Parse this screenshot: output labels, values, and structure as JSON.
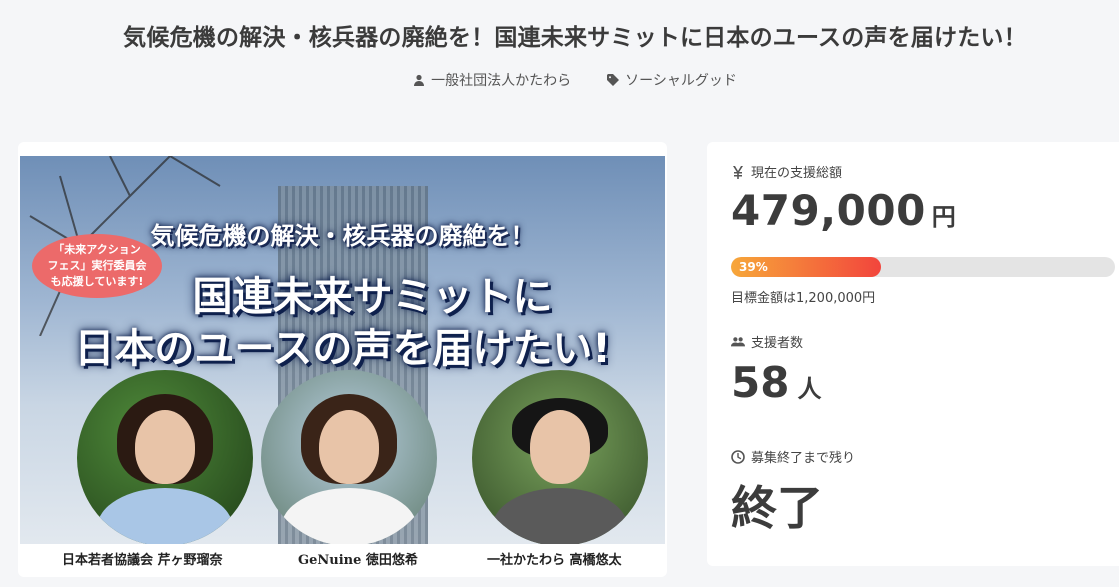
{
  "project": {
    "title": "気候危機の解決・核兵器の廃絶を！国連未来サミットに日本のユースの声を届けたい！",
    "owner": "一般社団法人かたわら",
    "category": "ソーシャルグッド",
    "owner_icon": "user-icon",
    "category_icon": "tag-icon"
  },
  "hero": {
    "headline_line1": "気候危機の解決・核兵器の廃絶を！",
    "headline_line2": "国連未来サミットに",
    "headline_line3": "日本のユースの声を届けたい!",
    "badge_line1": "「未来アクション",
    "badge_line2": "フェス」実行委員会",
    "badge_line3": "も応援しています!",
    "captions": [
      "日本若者協議会 芹ヶ野瑠奈",
      "GeNuine 徳田悠希",
      "一社かたわら 高橋悠太"
    ]
  },
  "stats": {
    "amount_label": "現在の支援総額",
    "amount_value": "479,000",
    "amount_unit": "円",
    "progress_percent": 39,
    "progress_label": "39%",
    "goal_text": "目標金額は1,200,000円",
    "backers_label": "支援者数",
    "backers_value": "58",
    "backers_unit": "人",
    "time_label": "募集終了まで残り",
    "time_value": "終了",
    "icons": [
      "yen-icon",
      "users-icon",
      "clock-icon"
    ]
  },
  "colors": {
    "progress_start": "#f7a73a",
    "progress_end": "#f2453c",
    "badge": "#ec6a6a"
  }
}
